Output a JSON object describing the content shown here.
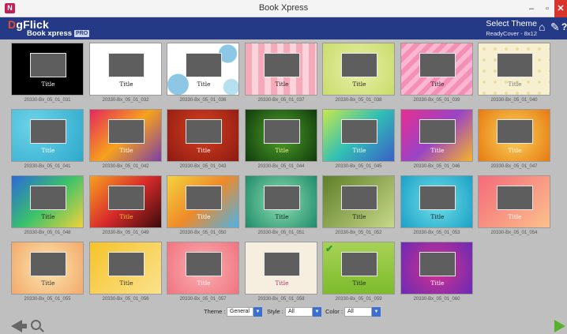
{
  "window": {
    "title": "Book Xpress",
    "min": "–",
    "max": "▫",
    "close": "✕",
    "app_icon": "N"
  },
  "header": {
    "brand_d": "D",
    "brand_rest": "gFlick",
    "subtitle": "Book xpress",
    "badge": "PRO",
    "select_theme": "Select Theme",
    "ready_cover": "ReadyCover - 8x12",
    "icons": {
      "home": "home-icon",
      "tools": "wrench-icon",
      "help": "help-icon"
    },
    "home_glyph": "⌂",
    "tool_glyph": "✎",
    "help_glyph": "?"
  },
  "themes": [
    {
      "code": "20330-Bx_05_01_031",
      "title": "Title",
      "title_color": "#ffffff",
      "bg": "#000000"
    },
    {
      "code": "20330-Bx_05_01_032",
      "title": "Title",
      "title_color": "#111111",
      "bg": "#ffffff"
    },
    {
      "code": "20330-Bx_05_01_036",
      "title": "Title",
      "title_color": "#222222",
      "bg": "radial-gradient(circle at 15% 80%, #8cc7e6 0 14%, transparent 15%), radial-gradient(circle at 85% 20%, #8cc7e6 0 12%, transparent 13%), radial-gradient(circle at 90% 85%, #b6dff0 0 10%, transparent 11%), #ffffff"
    },
    {
      "code": "20330-Bx_05_01_037",
      "title": "Title",
      "title_color": "#222222",
      "bg": "repeating-linear-gradient(90deg, #f6a9b8 0 8px, #fbd3db 8px 16px)"
    },
    {
      "code": "20330-Bx_05_01_038",
      "title": "Title",
      "title_color": "#222222",
      "bg": "radial-gradient(circle at 50% 50%, #e9f0a8, #c9dc6c)"
    },
    {
      "code": "20330-Bx_05_01_039",
      "title": "Title",
      "title_color": "#222222",
      "bg": "repeating-linear-gradient(135deg, #f58fb5 0 6px, #f9b8d0 6px 12px)"
    },
    {
      "code": "20330-Bx_05_01_040",
      "title": "Title",
      "title_color": "#777777",
      "bg": "radial-gradient(circle, #e8dea0 20%, #f6f0d0 21%) 0 0 / 14px 14px, #f6f0d0"
    },
    {
      "code": "20330-Bx_05_01_041",
      "title": "Title",
      "title_color": "#ffffff",
      "bg": "radial-gradient(circle at 30% 30%, #6cd3e8, #2da9cc)"
    },
    {
      "code": "20330-Bx_05_01_042",
      "title": "Title",
      "title_color": "#ffffff",
      "bg": "linear-gradient(135deg, #e4285c, #f7a21c, #7b3fa6)"
    },
    {
      "code": "20330-Bx_05_01_043",
      "title": "Title",
      "title_color": "#ffffff",
      "bg": "radial-gradient(circle at 50% 40%, #d8401f, #8c1a12)"
    },
    {
      "code": "20330-Bx_05_01_044",
      "title": "Title",
      "title_color": "#f2f29a",
      "bg": "radial-gradient(circle at 50% 50%, #4fa22a, #103b0c)"
    },
    {
      "code": "20330-Bx_05_01_045",
      "title": "Title",
      "title_color": "#ffffff",
      "bg": "linear-gradient(135deg, #c7e84a, #31bfb5, #3a5fc8)"
    },
    {
      "code": "20330-Bx_05_01_046",
      "title": "Title",
      "title_color": "#ffffff",
      "bg": "linear-gradient(135deg, #e62f8f, #9a43c6, #f5b42a)"
    },
    {
      "code": "20330-Bx_05_01_047",
      "title": "Title",
      "title_color": "#ffffff",
      "bg": "radial-gradient(circle at 50% 50%, #fad35a, #e77a12)"
    },
    {
      "code": "20330-Bx_05_01_048",
      "title": "Title",
      "title_color": "#222222",
      "bg": "linear-gradient(135deg, #2a6ad8, #3bc26a, #f0d23a)"
    },
    {
      "code": "20330-Bx_05_01_049",
      "title": "Title",
      "title_color": "#f5c02a",
      "bg": "linear-gradient(135deg, #f7a020, #d82b2b, #3b0b0b)"
    },
    {
      "code": "20330-Bx_05_01_050",
      "title": "Title",
      "title_color": "#ffffff",
      "bg": "linear-gradient(135deg, #f4d23c, #ee8a2a, #4fb2e6)"
    },
    {
      "code": "20330-Bx_05_01_051",
      "title": "Title",
      "title_color": "#1c1c1c",
      "bg": "radial-gradient(circle at 50% 50%, #8fe0b2, #1f8a6a)"
    },
    {
      "code": "20330-Bx_05_01_052",
      "title": "Title",
      "title_color": "#1c1c1c",
      "bg": "linear-gradient(135deg, #5f7f28, #c7d88a)"
    },
    {
      "code": "20330-Bx_05_01_053",
      "title": "Title",
      "title_color": "#1c1c1c",
      "bg": "radial-gradient(circle at 50% 50%, #71e0ea, #1ba0c6)"
    },
    {
      "code": "20330-Bx_05_01_054",
      "title": "Title",
      "title_color": "#ffffff",
      "bg": "linear-gradient(135deg, #f46a7a, #fcc08c)"
    },
    {
      "code": "20330-Bx_05_01_055",
      "title": "Title",
      "title_color": "#333333",
      "bg": "radial-gradient(circle at 50% 50%, #fbe7b0, #f3a96a)"
    },
    {
      "code": "20330-Bx_05_01_056",
      "title": "Title",
      "title_color": "#333333",
      "bg": "linear-gradient(135deg, #f5c32a, #fbe28c)"
    },
    {
      "code": "20330-Bx_05_01_057",
      "title": "Title",
      "title_color": "#ffffff",
      "bg": "radial-gradient(circle at 50% 50%, #fbb0b4, #f0747e)"
    },
    {
      "code": "20330-Bx_05_01_058",
      "title": "Title",
      "title_color": "#b0306a",
      "bg": "#f6efe0"
    },
    {
      "code": "20330-Bx_05_01_059",
      "title": "Title",
      "title_color": "#222222",
      "bg": "linear-gradient(180deg, #a8d256, #7dbb2c)",
      "selected": true
    },
    {
      "code": "20330-Bx_05_01_060",
      "title": "Title",
      "title_color": "#ffffff",
      "bg": "radial-gradient(circle at 50% 50%, #d8318c, #6a2bb4)"
    }
  ],
  "filters": {
    "theme_label": "Theme :",
    "theme_value": "General",
    "style_label": "Style :",
    "style_value": "All",
    "color_label": "Color :",
    "color_value": "All",
    "drop_glyph": "▼"
  },
  "nav": {
    "back": "back-arrow-icon",
    "zoom": "zoom-icon",
    "next": "next-arrow-icon"
  }
}
